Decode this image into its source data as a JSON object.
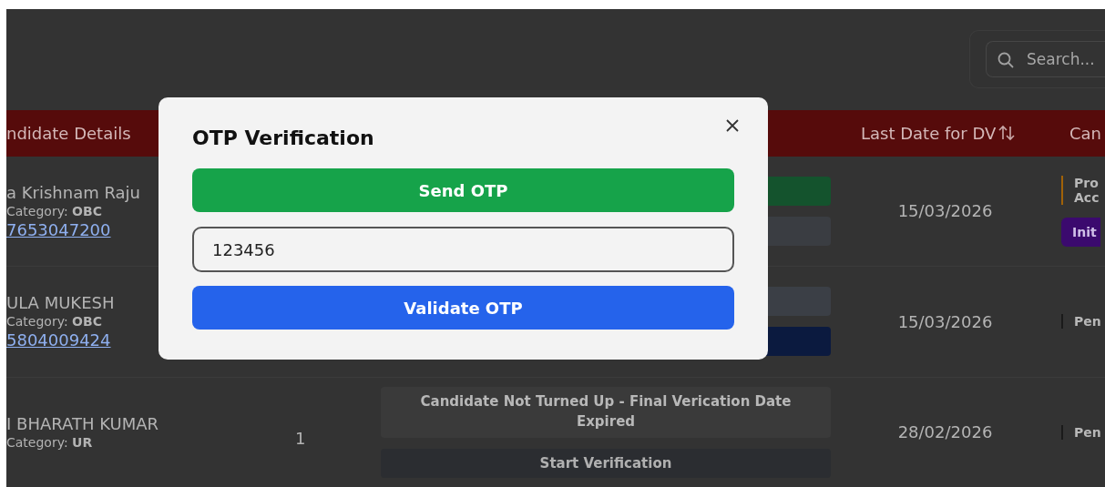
{
  "search": {
    "placeholder": "Search..."
  },
  "table": {
    "columns": [
      {
        "label": "ndidate Details"
      },
      {
        "label": "Last Date for DV",
        "sortable": true
      },
      {
        "label": "Can"
      }
    ],
    "rows": [
      {
        "name": "a Krishnam Raju",
        "category_label": "Category:",
        "category": "OBC",
        "phone": "7653047200",
        "actions": [
          {
            "kind": "button",
            "color": "#14532d"
          },
          {
            "kind": "button",
            "color": "#3a3d42"
          }
        ],
        "last_date": "15/03/2026",
        "status": {
          "lines": [
            "Pro",
            "Acc"
          ],
          "color": "#a16207"
        },
        "status_button": {
          "label": "Init",
          "color": "#3b0a6e"
        }
      },
      {
        "name": "ULA MUKESH",
        "category_label": "Category:",
        "category": "OBC",
        "phone": "5804009424",
        "actions": [
          {
            "kind": "button",
            "color": "#3b3f46"
          },
          {
            "kind": "button",
            "color": "#0b1a3f"
          }
        ],
        "last_date": "15/03/2026",
        "status": {
          "lines": [
            "Pen"
          ],
          "color": "#1a1a1a"
        }
      },
      {
        "name": "I BHARATH KUMAR",
        "category_label": "Category:",
        "category": "UR",
        "count": "1",
        "actions": [
          {
            "kind": "note",
            "label": "Candidate Not Turned Up - Final Verication Date Expired",
            "color": "#3a3a3a"
          },
          {
            "kind": "button",
            "label": "Start Verification",
            "color": "#2b2d31"
          }
        ],
        "last_date": "28/02/2026",
        "status": {
          "lines": [
            "Pen"
          ],
          "color": "#1a1a1a"
        }
      }
    ]
  },
  "modal": {
    "title": "OTP Verification",
    "send_button": "Send OTP",
    "otp_field": {
      "value": "123456",
      "focused": true
    },
    "validate_button": "Validate OTP"
  }
}
